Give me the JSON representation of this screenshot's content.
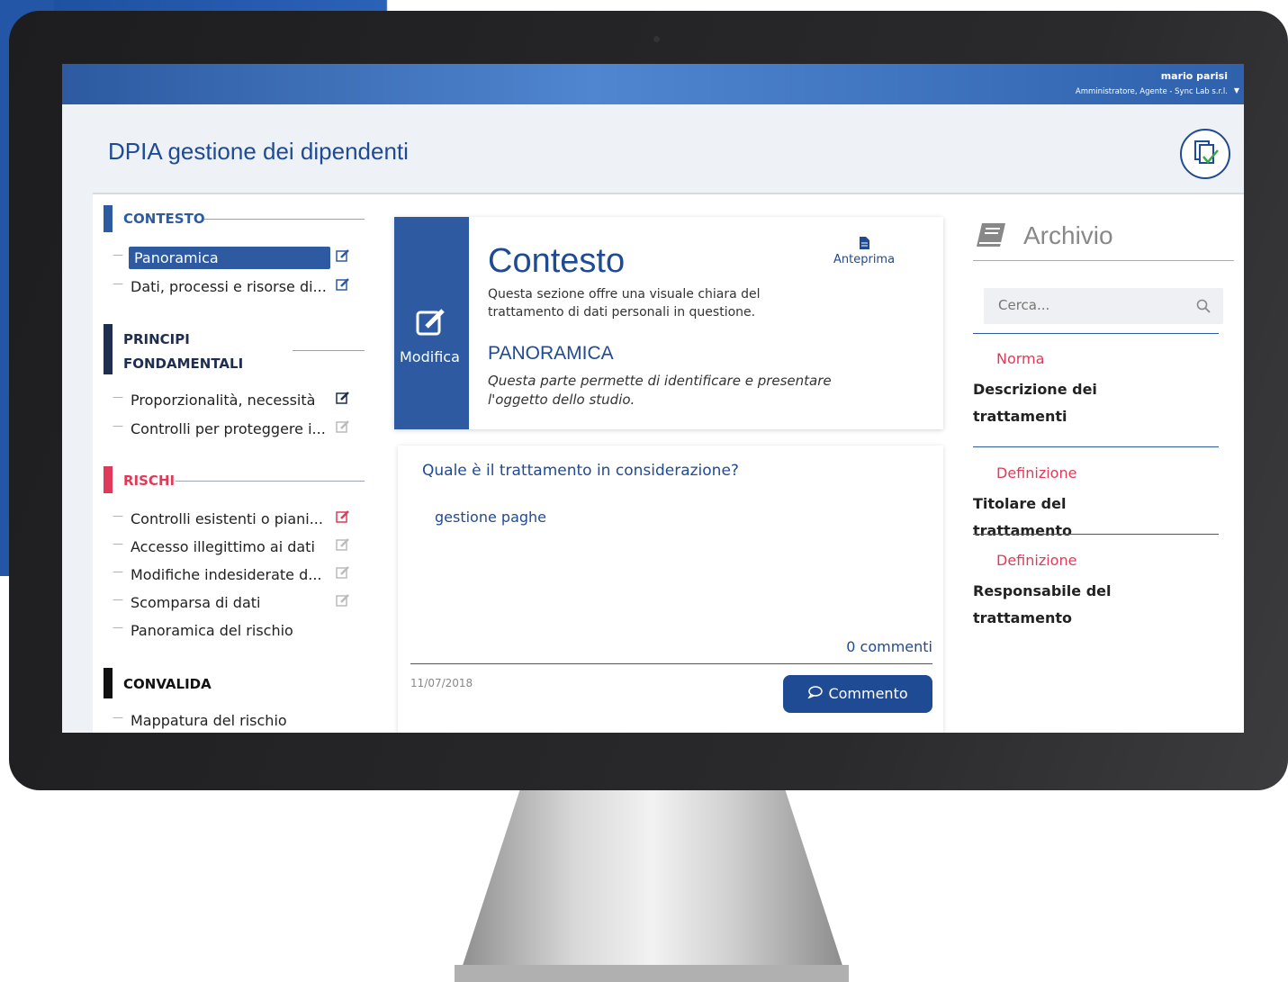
{
  "header": {
    "user_name": "mario parisi",
    "user_role": "Amministratore, Agente - Sync Lab s.r.l."
  },
  "page": {
    "title": "DPIA gestione dei dipendenti"
  },
  "sidebar": {
    "sections": [
      {
        "label": "CONTESTO",
        "color": "#2d5aa1",
        "items": [
          {
            "label": "Panoramica"
          },
          {
            "label": "Dati, processi e risorse di..."
          }
        ]
      },
      {
        "label_line1": "PRINCIPI",
        "label_line2": "FONDAMENTALI",
        "color": "#1f2d4e",
        "items": [
          {
            "label": "Proporzionalità, necessità"
          },
          {
            "label": "Controlli per proteggere i..."
          }
        ]
      },
      {
        "label": "RISCHI",
        "color": "#e03a5a",
        "items": [
          {
            "label": "Controlli esistenti o piani..."
          },
          {
            "label": "Accesso illegittimo ai dati"
          },
          {
            "label": "Modifiche indesiderate d..."
          },
          {
            "label": "Scomparsa di dati"
          },
          {
            "label": "Panoramica del rischio"
          }
        ]
      },
      {
        "label": "CONVALIDA",
        "color": "#111111",
        "items": [
          {
            "label": "Mappatura del rischio"
          }
        ]
      }
    ]
  },
  "main": {
    "edit_label": "Modifica",
    "title": "Contesto",
    "description": "Questa sezione offre una visuale chiara del trattamento di dati personali in questione.",
    "preview_label": "Anteprima",
    "subtitle": "PANORAMICA",
    "subdescription": "Questa parte permette di identificare e presentare l'oggetto dello studio.",
    "question": "Quale è il trattamento in considerazione?",
    "answer": "gestione paghe",
    "comments_count": "0 commenti",
    "date": "11/07/2018",
    "comment_button": "Commento"
  },
  "archive": {
    "title": "Archivio",
    "search_placeholder": "Cerca...",
    "entries": [
      {
        "category": "Norma",
        "name": "Descrizione dei trattamenti"
      },
      {
        "category": "Definizione",
        "name": "Titolare del trattamento"
      },
      {
        "category": "Definizione",
        "name": "Responsabile del trattamento"
      }
    ]
  },
  "colors": {
    "primary": "#2d5aa1",
    "accent_red": "#e03a5a"
  }
}
